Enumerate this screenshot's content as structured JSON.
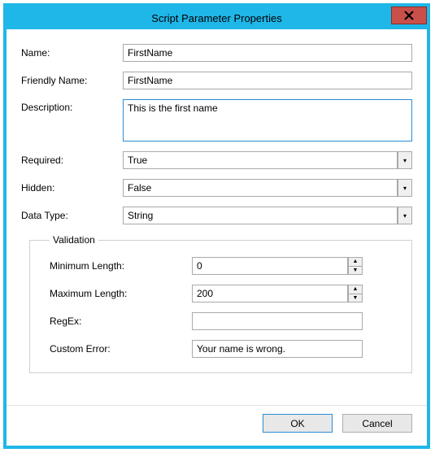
{
  "window": {
    "title": "Script Parameter Properties",
    "close_x": "X"
  },
  "fields": {
    "name_label": "Name:",
    "name_value": "FirstName",
    "friendly_label": "Friendly Name:",
    "friendly_value": "FirstName",
    "description_label": "Description:",
    "description_value": "This is the first name",
    "required_label": "Required:",
    "required_value": "True",
    "hidden_label": "Hidden:",
    "hidden_value": "False",
    "datatype_label": "Data Type:",
    "datatype_value": "String"
  },
  "validation": {
    "legend": "Validation",
    "min_label": "Minimum Length:",
    "min_value": "0",
    "max_label": "Maximum Length:",
    "max_value": "200",
    "regex_label": "RegEx:",
    "regex_value": "",
    "custom_error_label": "Custom Error:",
    "custom_error_value": "Your name is wrong."
  },
  "buttons": {
    "ok": "OK",
    "cancel": "Cancel"
  }
}
